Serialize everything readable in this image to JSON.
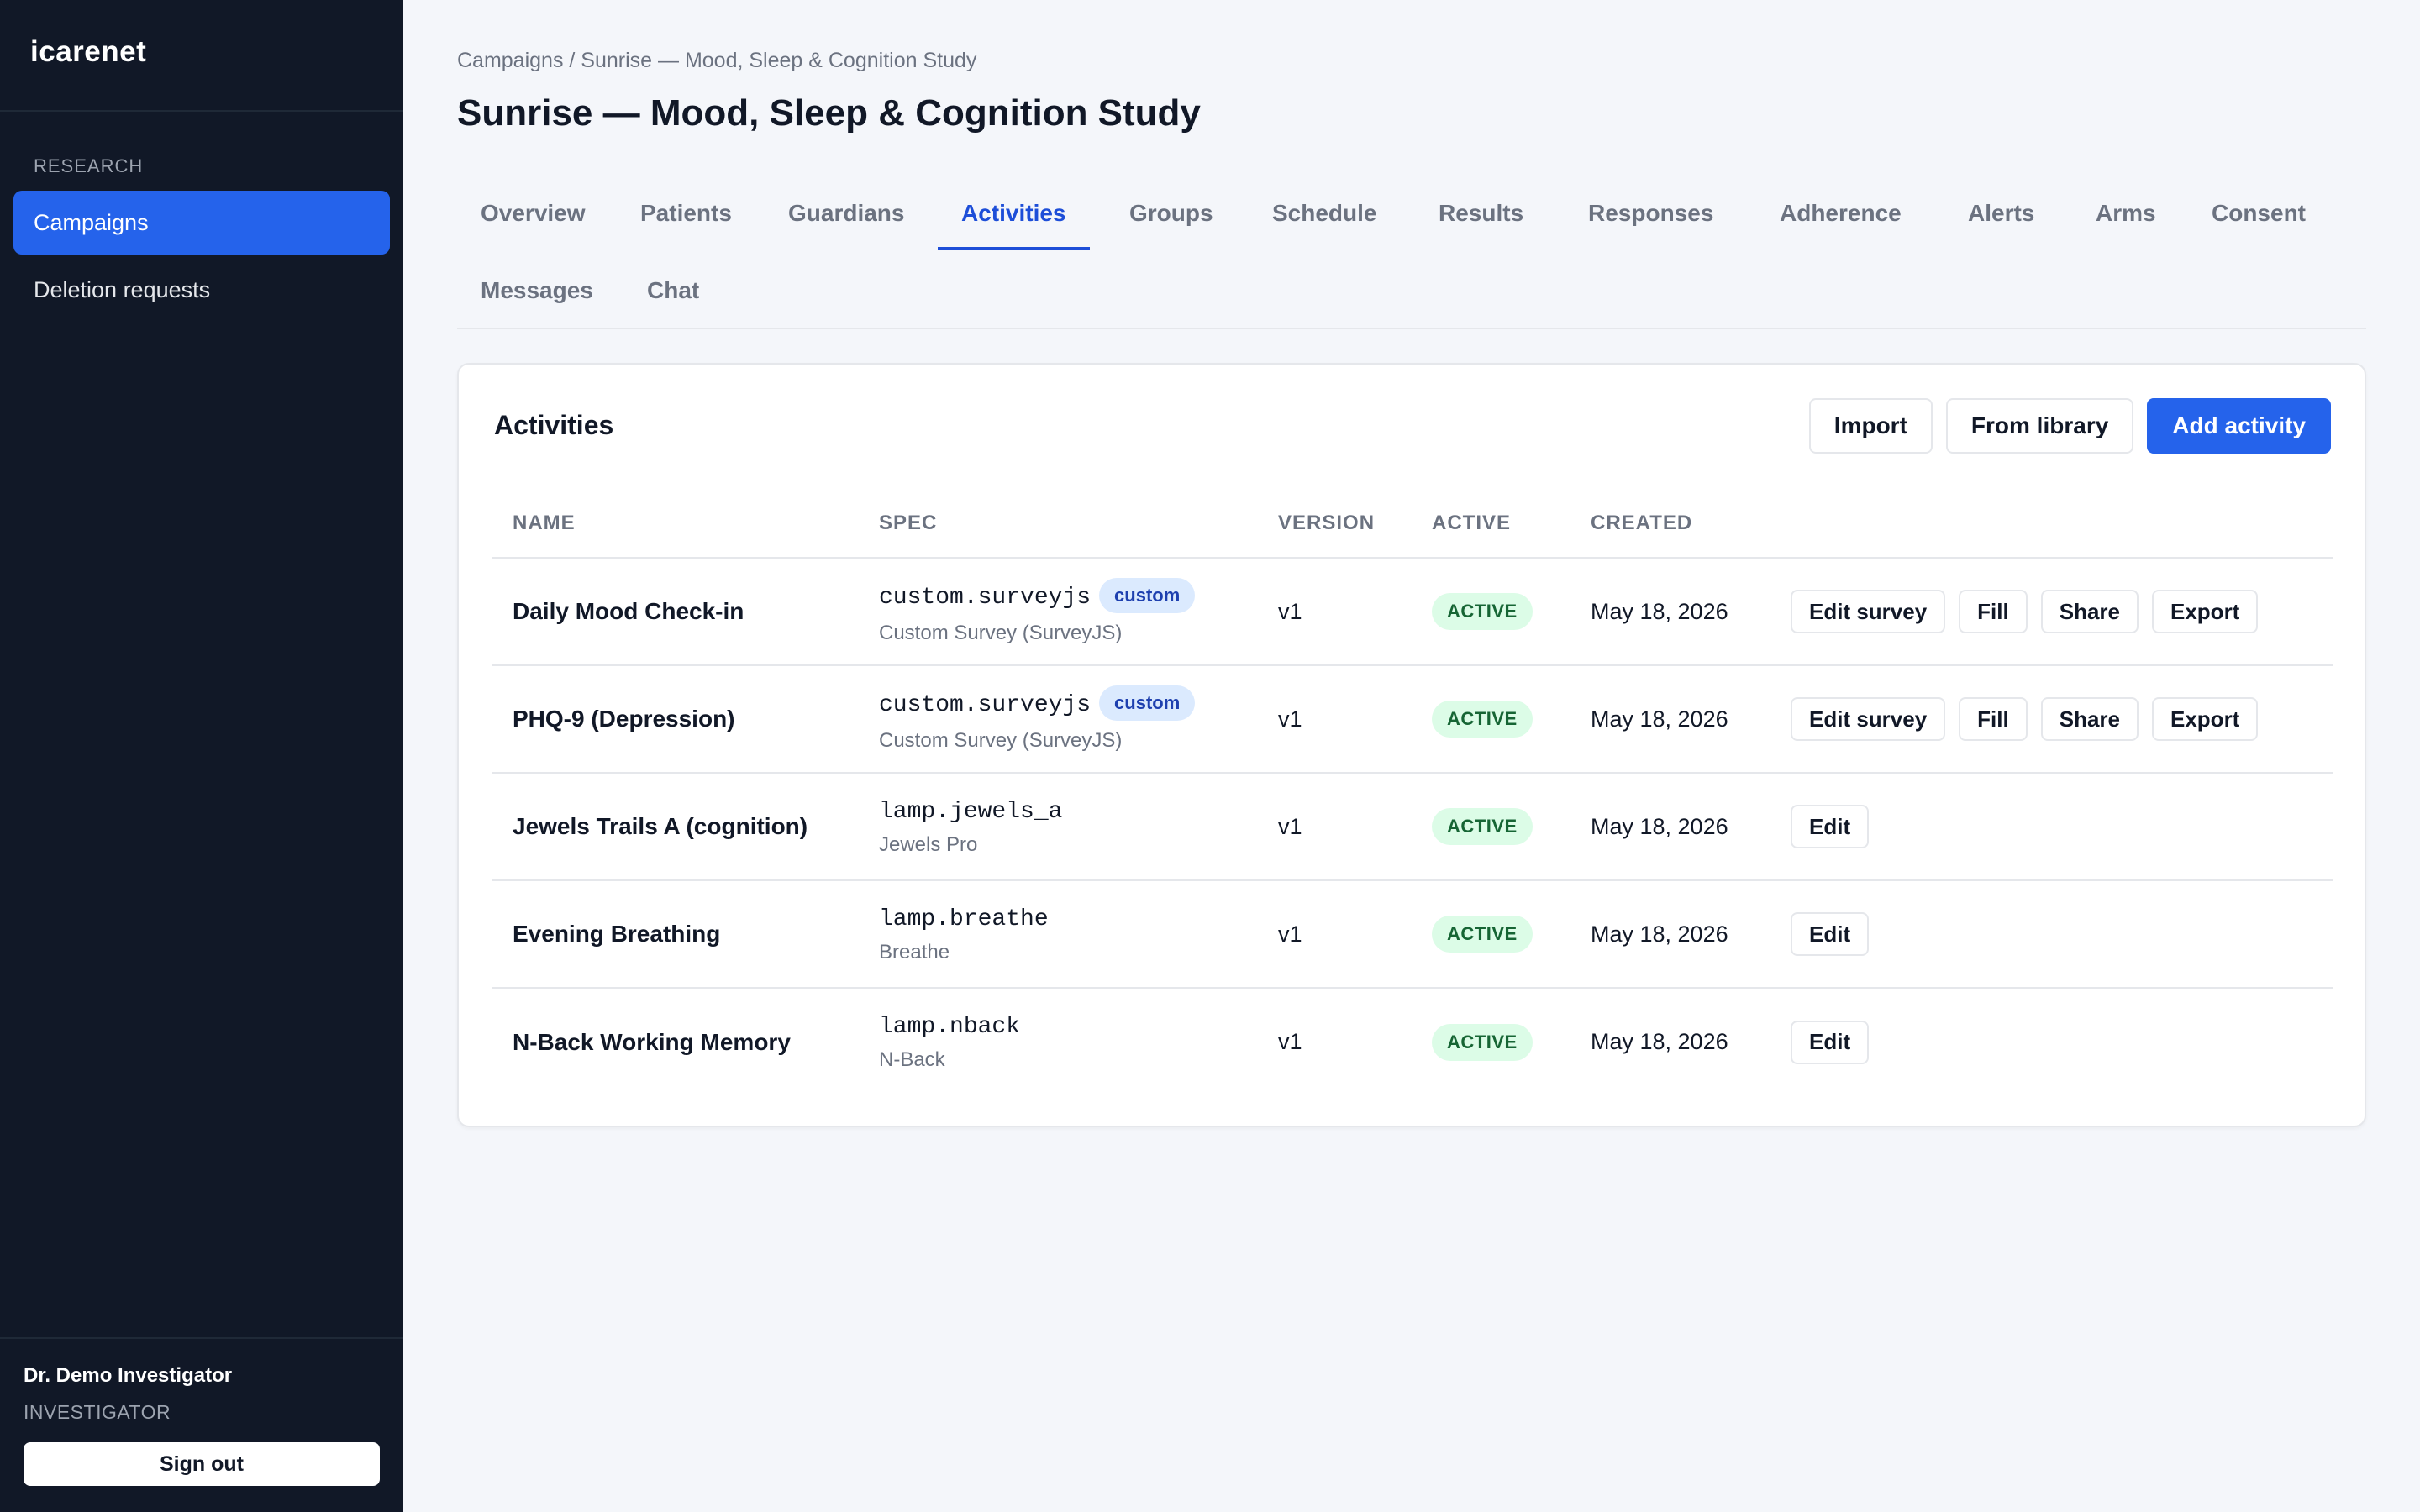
{
  "app": {
    "brand": "icarenet"
  },
  "sidebar": {
    "section_label": "RESEARCH",
    "items": [
      {
        "label": "Campaigns",
        "active": true
      },
      {
        "label": "Deletion requests",
        "active": false
      }
    ],
    "user": {
      "name": "Dr. Demo Investigator",
      "role": "INVESTIGATOR"
    },
    "signout_label": "Sign out"
  },
  "header": {
    "breadcrumb": "Campaigns / Sunrise — Mood, Sleep & Cognition Study",
    "title": "Sunrise — Mood, Sleep & Cognition Study"
  },
  "tabs": [
    {
      "label": "Overview",
      "active": false
    },
    {
      "label": "Patients",
      "active": false
    },
    {
      "label": "Guardians",
      "active": false
    },
    {
      "label": "Activities",
      "active": true
    },
    {
      "label": "Groups",
      "active": false
    },
    {
      "label": "Schedule",
      "active": false
    },
    {
      "label": "Results",
      "active": false
    },
    {
      "label": "Responses",
      "active": false
    },
    {
      "label": "Adherence",
      "active": false
    },
    {
      "label": "Alerts",
      "active": false
    },
    {
      "label": "Arms",
      "active": false
    },
    {
      "label": "Consent",
      "active": false
    },
    {
      "label": "Messages",
      "active": false
    },
    {
      "label": "Chat",
      "active": false
    }
  ],
  "card": {
    "title": "Activities",
    "actions": {
      "import": "Import",
      "from_library": "From library",
      "add": "Add activity"
    },
    "columns": {
      "name": "NAME",
      "spec": "SPEC",
      "version": "VERSION",
      "active": "ACTIVE",
      "created": "CREATED"
    },
    "rows": [
      {
        "name": "Daily Mood Check-in",
        "spec": "custom.surveyjs",
        "spec_badge": "custom",
        "spec_sub": "Custom Survey (SurveyJS)",
        "version": "v1",
        "status": "ACTIVE",
        "created": "May 18, 2026",
        "actions": [
          "Edit survey",
          "Fill",
          "Share",
          "Export"
        ]
      },
      {
        "name": "PHQ-9 (Depression)",
        "spec": "custom.surveyjs",
        "spec_badge": "custom",
        "spec_sub": "Custom Survey (SurveyJS)",
        "version": "v1",
        "status": "ACTIVE",
        "created": "May 18, 2026",
        "actions": [
          "Edit survey",
          "Fill",
          "Share",
          "Export"
        ]
      },
      {
        "name": "Jewels Trails A (cognition)",
        "spec": "lamp.jewels_a",
        "spec_badge": "",
        "spec_sub": "Jewels Pro",
        "version": "v1",
        "status": "ACTIVE",
        "created": "May 18, 2026",
        "actions": [
          "Edit"
        ]
      },
      {
        "name": "Evening Breathing",
        "spec": "lamp.breathe",
        "spec_badge": "",
        "spec_sub": "Breathe",
        "version": "v1",
        "status": "ACTIVE",
        "created": "May 18, 2026",
        "actions": [
          "Edit"
        ]
      },
      {
        "name": "N-Back Working Memory",
        "spec": "lamp.nback",
        "spec_badge": "",
        "spec_sub": "N-Back",
        "version": "v1",
        "status": "ACTIVE",
        "created": "May 18, 2026",
        "actions": [
          "Edit"
        ]
      }
    ]
  },
  "colors": {
    "accent": "#2563eb",
    "sidebar_bg": "#111827",
    "active_badge_bg": "#dcfce7",
    "custom_badge_bg": "#dbeafe"
  }
}
